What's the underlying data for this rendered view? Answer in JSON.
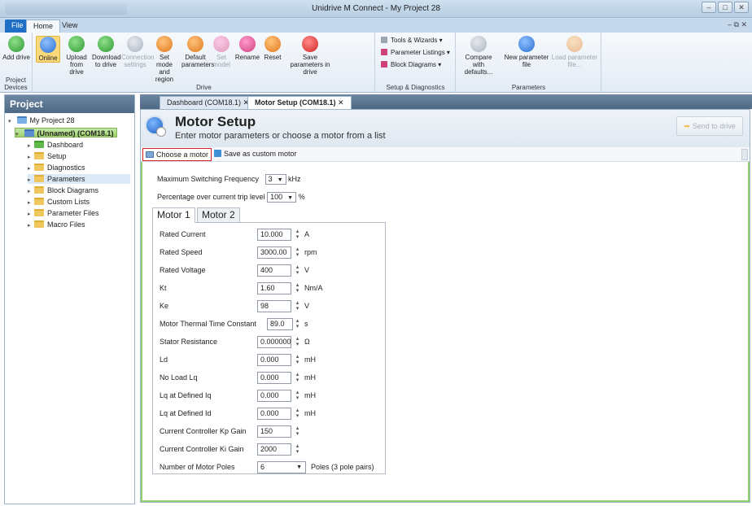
{
  "window": {
    "title": "Unidrive M Connect - My Project 28",
    "controls": {
      "minimize": "–",
      "restore": "□",
      "close": "✕"
    }
  },
  "ribbon_tabs": {
    "file": "File",
    "home": "Home",
    "view": "View",
    "right": "–  ⧉  ✕"
  },
  "ribbon": {
    "groups": {
      "project_devices": "Project Devices",
      "drive": "Drive",
      "setup_diagnostics": "Setup & Diagnostics",
      "parameters": "Parameters"
    },
    "buttons": {
      "add_drive": "Add drive",
      "online": "Online",
      "upload": "Upload from drive",
      "download": "Download to drive",
      "connection": "Connection settings",
      "set_mode": "Set mode and region",
      "default": "Default parameters",
      "set_model": "Set model",
      "rename": "Rename",
      "reset": "Reset",
      "save_params": "Save parameters in drive",
      "compare": "Compare with defaults...",
      "new_param_file": "New parameter file",
      "load_param_file": "Load parameter file..."
    },
    "small_items": {
      "tools": "Tools & Wizards ▾",
      "param_listings": "Parameter Listings ▾",
      "block_diagrams": "Block Diagrams ▾"
    },
    "colors": {
      "file_tab": "#1f6fc4",
      "online_active": "#fbd97a"
    }
  },
  "project": {
    "header": "Project",
    "root": "My Project 28",
    "drive": "(Unnamed) (COM18.1)",
    "items": [
      "Dashboard",
      "Setup",
      "Diagnostics",
      "Parameters",
      "Block Diagrams",
      "Custom Lists",
      "Parameter Files",
      "Macro Files"
    ],
    "selected": "Parameters"
  },
  "doc_tabs": {
    "dashboard": "Dashboard (COM18.1) ✕",
    "motor": "Motor Setup (COM18.1) ✕"
  },
  "motor_setup": {
    "title": "Motor Setup",
    "subtitle": "Enter motor parameters or choose a motor from a list",
    "send_button": "Send to drive",
    "toolbar": {
      "choose": "Choose a motor",
      "save_custom": "Save as custom motor"
    },
    "max_switching": {
      "label": "Maximum Switching Frequency",
      "value": "3",
      "unit": "kHz"
    },
    "overcurrent": {
      "label": "Percentage over current trip level",
      "value": "100",
      "unit": "%"
    },
    "tabs": [
      "Motor 1",
      "Motor 2"
    ],
    "active_tab": "Motor 1",
    "params": [
      {
        "label": "Rated Current",
        "value": "10.000",
        "unit": "A"
      },
      {
        "label": "Rated Speed",
        "value": "3000.00",
        "unit": "rpm"
      },
      {
        "label": "Rated Voltage",
        "value": "400",
        "unit": "V"
      },
      {
        "label": "Kt",
        "value": "1.60",
        "unit": "Nm/A"
      },
      {
        "label": "Ke",
        "value": "98",
        "unit": "V"
      },
      {
        "label": "Motor Thermal Time Constant",
        "value": "89.0",
        "unit": "s"
      },
      {
        "label": "Stator Resistance",
        "value": "0.000000",
        "unit": "Ω"
      },
      {
        "label": "Ld",
        "value": "0.000",
        "unit": "mH"
      },
      {
        "label": "No Load Lq",
        "value": "0.000",
        "unit": "mH"
      },
      {
        "label": "Lq at Defined Iq",
        "value": "0.000",
        "unit": "mH"
      },
      {
        "label": "Lq at Defined Id",
        "value": "0.000",
        "unit": "mH"
      },
      {
        "label": "Current Controller Kp Gain",
        "value": "150",
        "unit": ""
      },
      {
        "label": "Current Controller Ki Gain",
        "value": "2000",
        "unit": ""
      }
    ],
    "poles": {
      "label": "Number of Motor Poles",
      "value": "6",
      "unit": "Poles (3 pole pairs)"
    }
  },
  "colors": {
    "highlight_border": "#d42222",
    "content_border": "#93d26b",
    "panel_header": "#4e6985"
  }
}
